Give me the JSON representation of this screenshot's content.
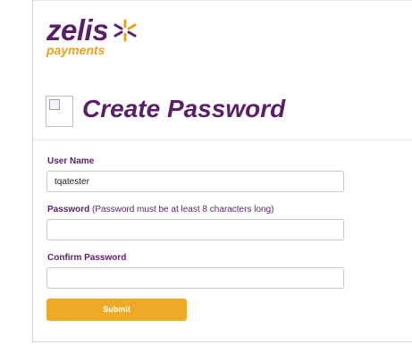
{
  "logo": {
    "brand": "zelis",
    "tagline": "payments",
    "mark_colors": [
      "#e8a317",
      "#5b1f69"
    ]
  },
  "heading": {
    "title": "Create Password"
  },
  "form": {
    "username": {
      "label": "User Name",
      "value": "tqatester"
    },
    "password": {
      "label": "Password",
      "hint": "(Password must be at least 8 characters long)",
      "value": ""
    },
    "confirm": {
      "label": "Confirm Password",
      "value": ""
    },
    "submit_label": "Submit"
  },
  "colors": {
    "brand_purple": "#5b1f69",
    "accent_gold": "#edaa26"
  }
}
